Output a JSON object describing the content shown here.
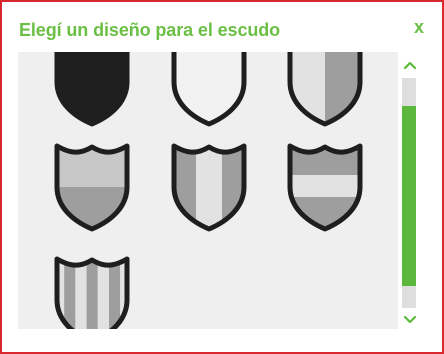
{
  "dialog": {
    "title": "Elegí un diseño para el escudo",
    "close_label": "x"
  },
  "shields": [
    {
      "name": "shield-design-solid-black",
      "pattern": "solid-dark"
    },
    {
      "name": "shield-design-plain-white",
      "pattern": "plain"
    },
    {
      "name": "shield-design-vertical-halves",
      "pattern": "vertical-halves"
    },
    {
      "name": "shield-design-horizontal-halves",
      "pattern": "horizontal-halves"
    },
    {
      "name": "shield-design-vertical-three-stripes",
      "pattern": "vertical-thirds"
    },
    {
      "name": "shield-design-horizontal-three-bands",
      "pattern": "horizontal-thirds"
    },
    {
      "name": "shield-design-vertical-many-stripes",
      "pattern": "vertical-stripes"
    }
  ],
  "colors": {
    "title_green": "#6cbf45",
    "frame_red": "#d7282f",
    "shield_outline": "#1e1e1e",
    "fill_light": "#e2e2e2",
    "fill_mid": "#c8c8c8",
    "fill_dark": "#9e9e9e",
    "scroll_thumb": "#5cb83c"
  },
  "scroll": {
    "up_icon": "chevron-up-icon",
    "down_icon": "chevron-down-icon",
    "position_fraction": 0.0
  }
}
